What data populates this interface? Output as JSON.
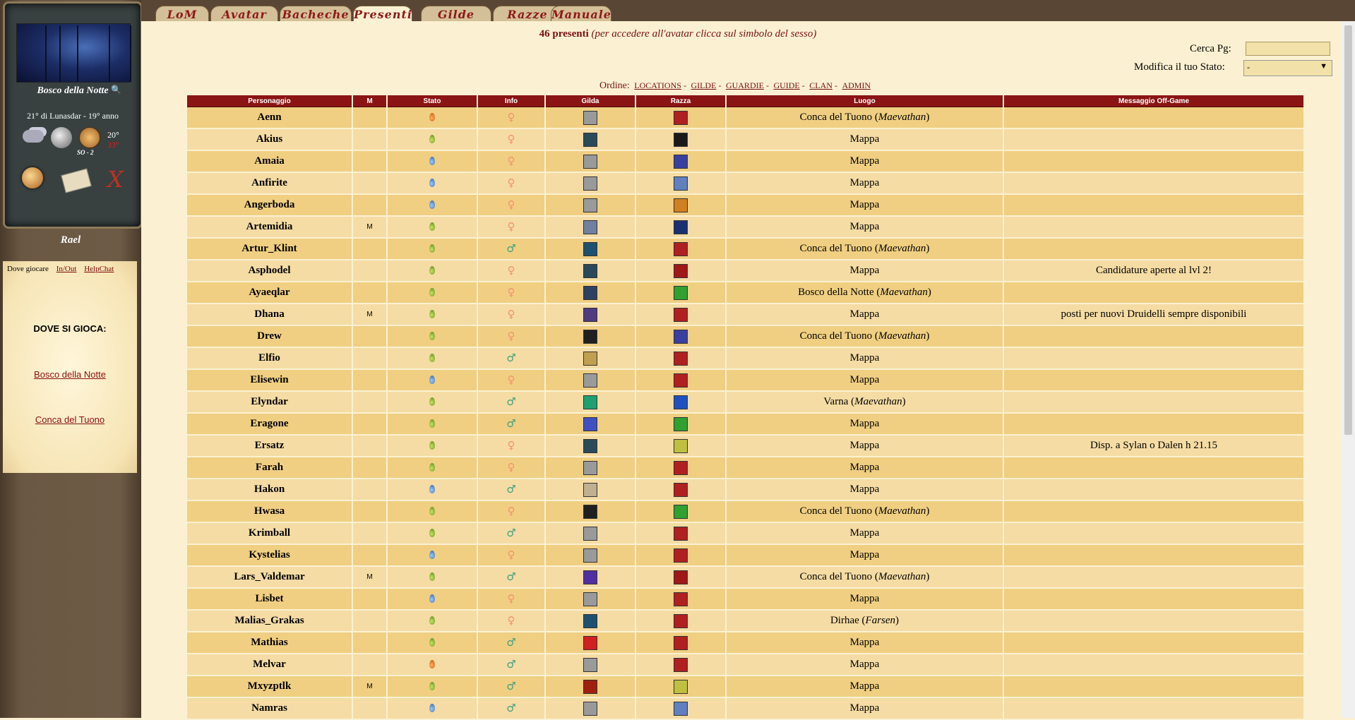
{
  "sidebar": {
    "location_name": "Bosco della Notte",
    "date": "21° di Lunasdar - 19° anno",
    "wind": "SO - 2",
    "temp_high": "20°",
    "temp_low": "33°",
    "username": "Rael",
    "tabs": {
      "dove": "Dove giocare",
      "inout": "In/Out",
      "helpchat": "HelpChat"
    },
    "dove_title": "DOVE SI GIOCA:",
    "places": [
      "Bosco della Notte",
      "Conca del Tuono"
    ]
  },
  "tabs": [
    "LoM",
    "Avatar",
    "Bacheche",
    "Presenti",
    "Gilde",
    "Razze",
    "Manuale"
  ],
  "active_tab": "Presenti",
  "header": {
    "count": "46 presenti",
    "hint": "(per accedere all'avatar clicca sul simbolo del sesso)",
    "search_label": "Cerca Pg:",
    "status_label": "Modifica il tuo Stato:",
    "status_value": "-",
    "order_label": "Ordine:",
    "order_links": [
      "LOCATIONS",
      "GILDE",
      "GUARDIE",
      "GUIDE",
      "CLAN",
      "ADMIN"
    ]
  },
  "table": {
    "columns": [
      "Personaggio",
      "M",
      "Stato",
      "Info",
      "Gilda",
      "Razza",
      "Luogo",
      "Messaggio Off-Game"
    ],
    "rows": [
      {
        "name": "Aenn",
        "m": "",
        "stato": "orange",
        "sex": "female",
        "gilda": "#9a9a9a",
        "razza": "#b02020",
        "luogo": "Conca del Tuono",
        "regione": "Maevathan",
        "msg": ""
      },
      {
        "name": "Akius",
        "m": "",
        "stato": "green",
        "sex": "female",
        "gilda": "#2a4a5a",
        "razza": "#1a1a1a",
        "luogo": "Mappa",
        "regione": "",
        "msg": ""
      },
      {
        "name": "Amaia",
        "m": "",
        "stato": "blue",
        "sex": "female",
        "gilda": "#9a9a9a",
        "razza": "#3a40a0",
        "luogo": "Mappa",
        "regione": "",
        "msg": ""
      },
      {
        "name": "Anfirite",
        "m": "",
        "stato": "blue",
        "sex": "female",
        "gilda": "#9a9a9a",
        "razza": "#6080c0",
        "luogo": "Mappa",
        "regione": "",
        "msg": ""
      },
      {
        "name": "Angerboda",
        "m": "",
        "stato": "blue",
        "sex": "female",
        "gilda": "#9a9a9a",
        "razza": "#d08020",
        "luogo": "Mappa",
        "regione": "",
        "msg": ""
      },
      {
        "name": "Artemidia",
        "m": "M",
        "stato": "green",
        "sex": "female",
        "gilda": "#7080a0",
        "razza": "#1a3070",
        "luogo": "Mappa",
        "regione": "",
        "msg": ""
      },
      {
        "name": "Artur_Klint",
        "m": "",
        "stato": "green",
        "sex": "male",
        "gilda": "#205070",
        "razza": "#b02020",
        "luogo": "Conca del Tuono",
        "regione": "Maevathan",
        "msg": ""
      },
      {
        "name": "Asphodel",
        "m": "",
        "stato": "green",
        "sex": "female",
        "gilda": "#2a4a5a",
        "razza": "#a01818",
        "luogo": "Mappa",
        "regione": "",
        "msg": "Candidature aperte al lvl 2!"
      },
      {
        "name": "Ayaeqlar",
        "m": "",
        "stato": "green",
        "sex": "female",
        "gilda": "#304060",
        "razza": "#30a030",
        "luogo": "Bosco della Notte",
        "regione": "Maevathan",
        "msg": ""
      },
      {
        "name": "Dhana",
        "m": "M",
        "stato": "green",
        "sex": "female",
        "gilda": "#503a80",
        "razza": "#b02020",
        "luogo": "Mappa",
        "regione": "",
        "msg": "posti per nuovi Druidelli sempre disponibili"
      },
      {
        "name": "Drew",
        "m": "",
        "stato": "green",
        "sex": "female",
        "gilda": "#202020",
        "razza": "#3a40a0",
        "luogo": "Conca del Tuono",
        "regione": "Maevathan",
        "msg": ""
      },
      {
        "name": "Elfio",
        "m": "",
        "stato": "green",
        "sex": "male",
        "gilda": "#c0a050",
        "razza": "#b02020",
        "luogo": "Mappa",
        "regione": "",
        "msg": ""
      },
      {
        "name": "Elisewin",
        "m": "",
        "stato": "blue",
        "sex": "female",
        "gilda": "#9a9a9a",
        "razza": "#b02020",
        "luogo": "Mappa",
        "regione": "",
        "msg": ""
      },
      {
        "name": "Elyndar",
        "m": "",
        "stato": "green",
        "sex": "male",
        "gilda": "#20a070",
        "razza": "#2050c0",
        "luogo": "Varna",
        "regione": "Maevathan",
        "msg": ""
      },
      {
        "name": "Eragone",
        "m": "",
        "stato": "green",
        "sex": "male",
        "gilda": "#4050c0",
        "razza": "#30a030",
        "luogo": "Mappa",
        "regione": "",
        "msg": ""
      },
      {
        "name": "Ersatz",
        "m": "",
        "stato": "green",
        "sex": "female",
        "gilda": "#2a4a5a",
        "razza": "#c0c040",
        "luogo": "Mappa",
        "regione": "",
        "msg": "Disp. a Sylan o Dalen h 21.15"
      },
      {
        "name": "Farah",
        "m": "",
        "stato": "green",
        "sex": "female",
        "gilda": "#9a9a9a",
        "razza": "#b02020",
        "luogo": "Mappa",
        "regione": "",
        "msg": ""
      },
      {
        "name": "Hakon",
        "m": "",
        "stato": "blue",
        "sex": "male",
        "gilda": "#c0b090",
        "razza": "#b02020",
        "luogo": "Mappa",
        "regione": "",
        "msg": ""
      },
      {
        "name": "Hwasa",
        "m": "",
        "stato": "green",
        "sex": "female",
        "gilda": "#202020",
        "razza": "#30a030",
        "luogo": "Conca del Tuono",
        "regione": "Maevathan",
        "msg": ""
      },
      {
        "name": "Krimball",
        "m": "",
        "stato": "green",
        "sex": "male",
        "gilda": "#9a9a9a",
        "razza": "#b02020",
        "luogo": "Mappa",
        "regione": "",
        "msg": ""
      },
      {
        "name": "Kystelias",
        "m": "",
        "stato": "blue",
        "sex": "female",
        "gilda": "#9a9a9a",
        "razza": "#b02020",
        "luogo": "Mappa",
        "regione": "",
        "msg": ""
      },
      {
        "name": "Lars_Valdemar",
        "m": "M",
        "stato": "green",
        "sex": "male",
        "gilda": "#5030a0",
        "razza": "#a01818",
        "luogo": "Conca del Tuono",
        "regione": "Maevathan",
        "msg": ""
      },
      {
        "name": "Lisbet",
        "m": "",
        "stato": "blue",
        "sex": "female",
        "gilda": "#9a9a9a",
        "razza": "#b02020",
        "luogo": "Mappa",
        "regione": "",
        "msg": ""
      },
      {
        "name": "Malias_Grakas",
        "m": "",
        "stato": "green",
        "sex": "female",
        "gilda": "#205070",
        "razza": "#b02020",
        "luogo": "Dirhae",
        "regione": "Farsen",
        "msg": ""
      },
      {
        "name": "Mathias",
        "m": "",
        "stato": "green",
        "sex": "male",
        "gilda": "#d02020",
        "razza": "#b02020",
        "luogo": "Mappa",
        "regione": "",
        "msg": ""
      },
      {
        "name": "Melvar",
        "m": "",
        "stato": "orange",
        "sex": "male",
        "gilda": "#9a9a9a",
        "razza": "#b02020",
        "luogo": "Mappa",
        "regione": "",
        "msg": ""
      },
      {
        "name": "Mxyzptlk",
        "m": "M",
        "stato": "green",
        "sex": "male",
        "gilda": "#a02010",
        "razza": "#c0c040",
        "luogo": "Mappa",
        "regione": "",
        "msg": ""
      },
      {
        "name": "Namras",
        "m": "",
        "stato": "blue",
        "sex": "male",
        "gilda": "#9a9a9a",
        "razza": "#6080c0",
        "luogo": "Mappa",
        "regione": "",
        "msg": ""
      }
    ]
  }
}
